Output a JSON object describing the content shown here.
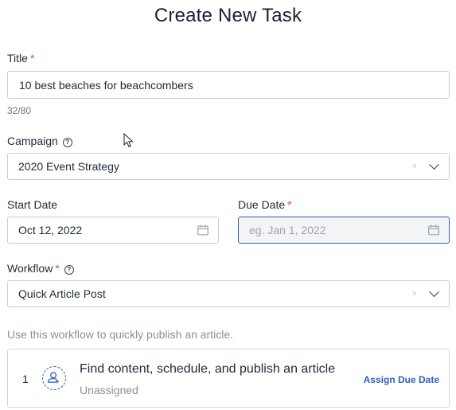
{
  "page_title": "Create New Task",
  "title_field": {
    "label": "Title",
    "required": "*",
    "value": "10 best beaches for beachcombers",
    "counter": "32/80"
  },
  "campaign": {
    "label": "Campaign",
    "help_icon": "question-icon",
    "value": "2020 Event Strategy",
    "clear": "×"
  },
  "start_date": {
    "label": "Start Date",
    "value": "Oct 12, 2022"
  },
  "due_date": {
    "label": "Due Date",
    "required": "*",
    "placeholder": "eg. Jan 1, 2022"
  },
  "workflow": {
    "label": "Workflow",
    "required": "*",
    "help_icon": "question-icon",
    "value": "Quick Article Post",
    "clear": "×",
    "hint": "Use this workflow to quickly publish an article."
  },
  "steps": [
    {
      "number": "1",
      "title": "Find content, schedule, and publish an article",
      "assignee": "Unassigned",
      "action": "Assign Due Date"
    }
  ],
  "help_glyph": "?",
  "colors": {
    "accent": "#2f5fc4",
    "required": "#e5484d"
  }
}
